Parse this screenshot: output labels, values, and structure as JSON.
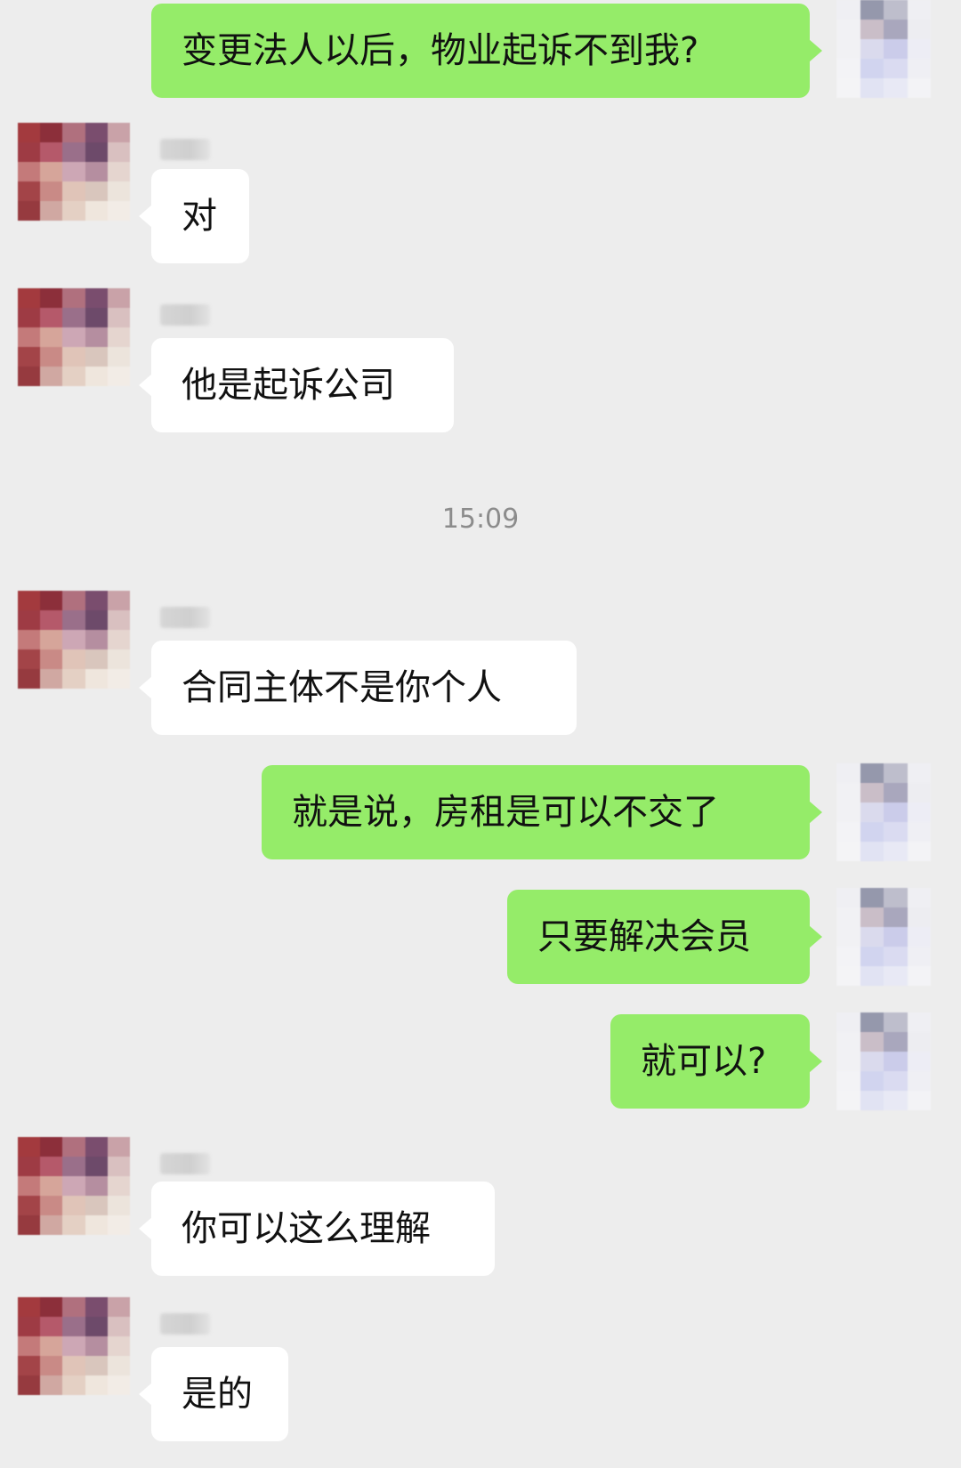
{
  "chat": {
    "timestamp": "15:09",
    "messages": [
      {
        "id": 0,
        "side": "out",
        "text": "变更法人以后，物业起诉不到我?"
      },
      {
        "id": 1,
        "side": "in",
        "text": "对"
      },
      {
        "id": 2,
        "side": "in",
        "text": "他是起诉公司"
      },
      {
        "id": 3,
        "side": "in",
        "text": "合同主体不是你个人"
      },
      {
        "id": 4,
        "side": "out",
        "text": "就是说，房租是可以不交了"
      },
      {
        "id": 5,
        "side": "out",
        "text": "只要解决会员"
      },
      {
        "id": 6,
        "side": "out",
        "text": "就可以?"
      },
      {
        "id": 7,
        "side": "in",
        "text": "你可以这么理解"
      },
      {
        "id": 8,
        "side": "in",
        "text": "是的"
      }
    ]
  },
  "colors": {
    "background": "#ededed",
    "outgoing_bubble": "#95ec69",
    "incoming_bubble": "#ffffff",
    "timestamp_text": "#8c8c8c"
  },
  "icons": {
    "incoming_avatar": "pixelated-avatar-icon",
    "outgoing_avatar": "pixelated-avatar-icon"
  }
}
